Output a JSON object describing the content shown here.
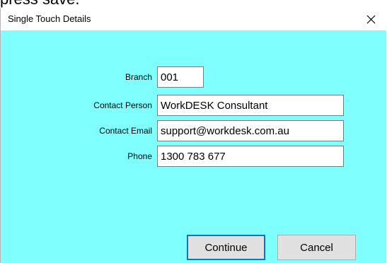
{
  "background": {
    "partial_text": "press save."
  },
  "dialog": {
    "title": "Single Touch Details",
    "close_icon": "close-icon",
    "client_color": "#80ffff",
    "fields": {
      "branch": {
        "label": "Branch",
        "value": "001"
      },
      "contact_person": {
        "label": "Contact Person",
        "value": "WorkDESK Consultant"
      },
      "contact_email": {
        "label": "Contact Email",
        "value": "support@workdesk.com.au"
      },
      "phone": {
        "label": "Phone",
        "value": "1300 783 677"
      }
    },
    "buttons": {
      "continue_label": "Continue",
      "cancel_label": "Cancel"
    }
  }
}
